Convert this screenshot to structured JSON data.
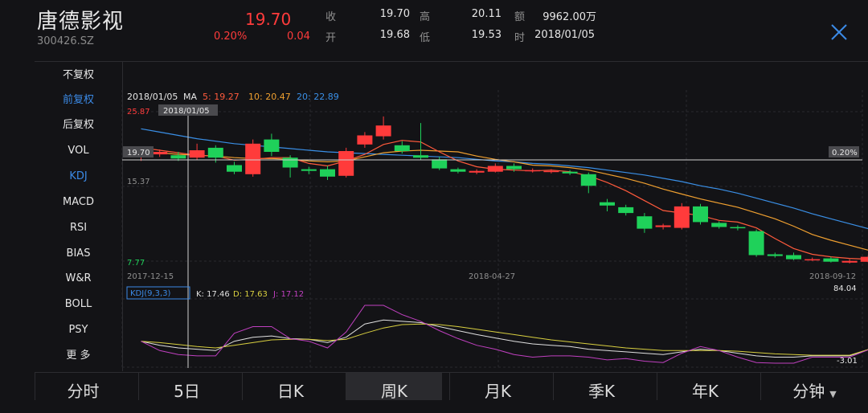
{
  "header": {
    "name": "唐德影视",
    "code": "300426.SZ",
    "price": "19.70",
    "change_pct": "0.20%",
    "change": "0.04",
    "close_label": "收",
    "close_value": "19.70",
    "open_label": "开",
    "open_value": "19.68",
    "high_label": "高",
    "high_value": "20.11",
    "low_label": "低",
    "low_value": "19.53",
    "amount_label": "额",
    "amount_value": "9962.00万",
    "time_label": "时",
    "time_value": "2018/01/05"
  },
  "sidebar": {
    "items": [
      "不复权",
      "前复权",
      "后复权",
      "VOL",
      "KDJ",
      "MACD",
      "RSI",
      "BIAS",
      "W&R",
      "BOLL",
      "PSY",
      "更 多"
    ],
    "active": [
      "前复权",
      "KDJ"
    ]
  },
  "ma_legend": {
    "date": "2018/01/05",
    "ma_label": "MA",
    "ma5": "5: 19.27",
    "ma10": "10: 20.47",
    "ma20": "20: 22.89"
  },
  "axis": {
    "y_top": "25.87",
    "y_cross": "19.70",
    "y_mid": "15.37",
    "y_bottom": "7.77",
    "cross_pct": "0.20%",
    "cursor_date": "2018/01/05",
    "x_labels": [
      "2017-12-15",
      "2018-04-27",
      "2018-09-12"
    ]
  },
  "kdj_legend": {
    "params": "KDJ(9,3,3)",
    "k": "K: 17.46",
    "d": "D: 17.63",
    "j": "J: 17.12",
    "max": "84.04",
    "min": "-3.01"
  },
  "tabs": {
    "items": [
      "分时",
      "5日",
      "日K",
      "周K",
      "月K",
      "季K",
      "年K",
      "分钟"
    ],
    "active": "周K"
  },
  "colors": {
    "up": "#ff3b3b",
    "down": "#1fd15a",
    "ma5": "#ff5a3c",
    "ma10": "#f0a030",
    "ma20": "#3a8fe6",
    "k": "#e0e0e0",
    "d": "#d9d040",
    "j": "#c040c0",
    "accent": "#3b8ae6"
  },
  "chart_data": {
    "type": "candlestick",
    "ylim": [
      7.77,
      25.87
    ],
    "x_labels": [
      "2017-12-15",
      "2018-04-27",
      "2018-09-12"
    ],
    "candles": [
      {
        "o": 20.5,
        "c": 20.9,
        "h": 21.6,
        "l": 19.9
      },
      {
        "o": 20.7,
        "c": 21.0,
        "h": 21.3,
        "l": 20.4
      },
      {
        "o": 20.6,
        "c": 20.2,
        "h": 21.0,
        "l": 19.9
      },
      {
        "o": 20.3,
        "c": 21.2,
        "h": 22.0,
        "l": 20.0
      },
      {
        "o": 21.5,
        "c": 20.3,
        "h": 21.8,
        "l": 19.7
      },
      {
        "o": 19.4,
        "c": 18.6,
        "h": 19.8,
        "l": 18.3
      },
      {
        "o": 18.3,
        "c": 22.0,
        "h": 22.5,
        "l": 18.0
      },
      {
        "o": 22.5,
        "c": 21.0,
        "h": 23.2,
        "l": 20.5
      },
      {
        "o": 20.3,
        "c": 19.1,
        "h": 20.6,
        "l": 17.9
      },
      {
        "o": 18.9,
        "c": 18.7,
        "h": 19.2,
        "l": 18.3
      },
      {
        "o": 18.9,
        "c": 18.0,
        "h": 19.3,
        "l": 17.6
      },
      {
        "o": 18.1,
        "c": 21.1,
        "h": 21.5,
        "l": 17.9
      },
      {
        "o": 21.9,
        "c": 23.0,
        "h": 23.4,
        "l": 21.5
      },
      {
        "o": 22.9,
        "c": 24.2,
        "h": 25.3,
        "l": 22.5
      },
      {
        "o": 21.8,
        "c": 21.1,
        "h": 22.3,
        "l": 20.8
      },
      {
        "o": 20.6,
        "c": 20.3,
        "h": 24.5,
        "l": 20.0
      },
      {
        "o": 20.1,
        "c": 19.0,
        "h": 20.4,
        "l": 18.8
      },
      {
        "o": 18.9,
        "c": 18.6,
        "h": 19.1,
        "l": 18.4
      },
      {
        "o": 18.5,
        "c": 18.7,
        "h": 18.9,
        "l": 18.3
      },
      {
        "o": 18.6,
        "c": 19.3,
        "h": 19.6,
        "l": 18.5
      },
      {
        "o": 19.3,
        "c": 18.9,
        "h": 19.6,
        "l": 18.6
      },
      {
        "o": 18.7,
        "c": 18.8,
        "h": 19.0,
        "l": 18.5
      },
      {
        "o": 18.6,
        "c": 18.7,
        "h": 18.9,
        "l": 18.4
      },
      {
        "o": 18.6,
        "c": 18.4,
        "h": 18.8,
        "l": 18.2
      },
      {
        "o": 18.3,
        "c": 16.9,
        "h": 18.5,
        "l": 16.0
      },
      {
        "o": 14.9,
        "c": 14.5,
        "h": 15.3,
        "l": 13.8
      },
      {
        "o": 14.3,
        "c": 13.6,
        "h": 14.6,
        "l": 13.3
      },
      {
        "o": 13.2,
        "c": 11.7,
        "h": 13.6,
        "l": 11.2
      },
      {
        "o": 11.9,
        "c": 12.1,
        "h": 12.3,
        "l": 11.6
      },
      {
        "o": 11.8,
        "c": 14.4,
        "h": 14.8,
        "l": 11.6
      },
      {
        "o": 14.4,
        "c": 12.5,
        "h": 14.7,
        "l": 12.2
      },
      {
        "o": 12.4,
        "c": 11.9,
        "h": 12.6,
        "l": 11.7
      },
      {
        "o": 11.9,
        "c": 11.8,
        "h": 12.1,
        "l": 11.5
      },
      {
        "o": 11.4,
        "c": 8.5,
        "h": 11.6,
        "l": 8.3
      },
      {
        "o": 8.6,
        "c": 8.4,
        "h": 8.8,
        "l": 8.2
      },
      {
        "o": 8.5,
        "c": 8.0,
        "h": 8.8,
        "l": 7.9
      },
      {
        "o": 8.0,
        "c": 8.0,
        "h": 8.2,
        "l": 7.8
      },
      {
        "o": 8.1,
        "c": 7.7,
        "h": 8.3,
        "l": 7.6
      },
      {
        "o": 7.6,
        "c": 7.8,
        "h": 8.0,
        "l": 7.5
      },
      {
        "o": 7.7,
        "c": 8.3,
        "h": 8.5,
        "l": 7.6
      }
    ],
    "ma5": [
      21.5,
      21.2,
      20.9,
      20.6,
      20.5,
      20.0,
      20.1,
      20.3,
      20.3,
      19.6,
      19.3,
      19.9,
      20.7,
      21.9,
      22.4,
      22.2,
      21.0,
      19.9,
      19.2,
      18.9,
      18.8,
      18.7,
      18.8,
      18.6,
      18.1,
      17.3,
      16.3,
      15.1,
      13.9,
      13.6,
      13.3,
      12.7,
      12.5,
      11.8,
      10.5,
      9.3,
      8.6,
      8.3,
      8.1,
      8.0
    ],
    "ma10": [
      21.0,
      20.9,
      20.7,
      20.6,
      20.5,
      20.3,
      20.2,
      20.2,
      20.1,
      19.9,
      19.8,
      19.9,
      20.4,
      20.9,
      21.1,
      21.2,
      21.1,
      21.0,
      20.5,
      20.1,
      19.8,
      19.4,
      19.3,
      19.1,
      18.8,
      18.3,
      17.8,
      17.2,
      16.5,
      15.9,
      15.3,
      14.8,
      14.3,
      13.6,
      12.9,
      12.0,
      11.0,
      10.3,
      9.7,
      9.1
    ],
    "ma20": [
      23.8,
      23.4,
      23.0,
      22.6,
      22.3,
      22.0,
      21.8,
      21.6,
      21.4,
      21.2,
      21.0,
      20.9,
      20.8,
      20.7,
      20.6,
      20.5,
      20.4,
      20.3,
      20.1,
      19.9,
      19.8,
      19.6,
      19.5,
      19.3,
      19.1,
      18.8,
      18.5,
      18.2,
      17.8,
      17.4,
      16.9,
      16.5,
      16.0,
      15.4,
      14.8,
      14.2,
      13.5,
      12.9,
      12.3,
      11.7
    ],
    "kdj": {
      "ylim": [
        -3.01,
        84.04
      ],
      "k": [
        30,
        24,
        20,
        18,
        16,
        30,
        36,
        38,
        34,
        33,
        28,
        36,
        56,
        62,
        60,
        58,
        52,
        46,
        40,
        35,
        30,
        26,
        24,
        22,
        18,
        16,
        14,
        12,
        10,
        14,
        18,
        16,
        12,
        8,
        6,
        6,
        8,
        8,
        8,
        17.46
      ],
      "d": [
        30,
        28,
        25,
        22,
        20,
        24,
        28,
        32,
        33,
        33,
        31,
        33,
        42,
        50,
        55,
        56,
        55,
        52,
        48,
        44,
        40,
        36,
        32,
        29,
        26,
        23,
        20,
        18,
        16,
        16,
        16,
        16,
        15,
        13,
        11,
        10,
        9,
        9,
        9,
        17.63
      ],
      "j": [
        30,
        16,
        10,
        8,
        8,
        42,
        52,
        52,
        34,
        30,
        20,
        44,
        84,
        84,
        70,
        60,
        46,
        34,
        24,
        18,
        10,
        6,
        8,
        8,
        6,
        2,
        4,
        0,
        -2,
        12,
        22,
        16,
        6,
        -2,
        -3,
        -3,
        6,
        6,
        6,
        17.12
      ]
    }
  }
}
